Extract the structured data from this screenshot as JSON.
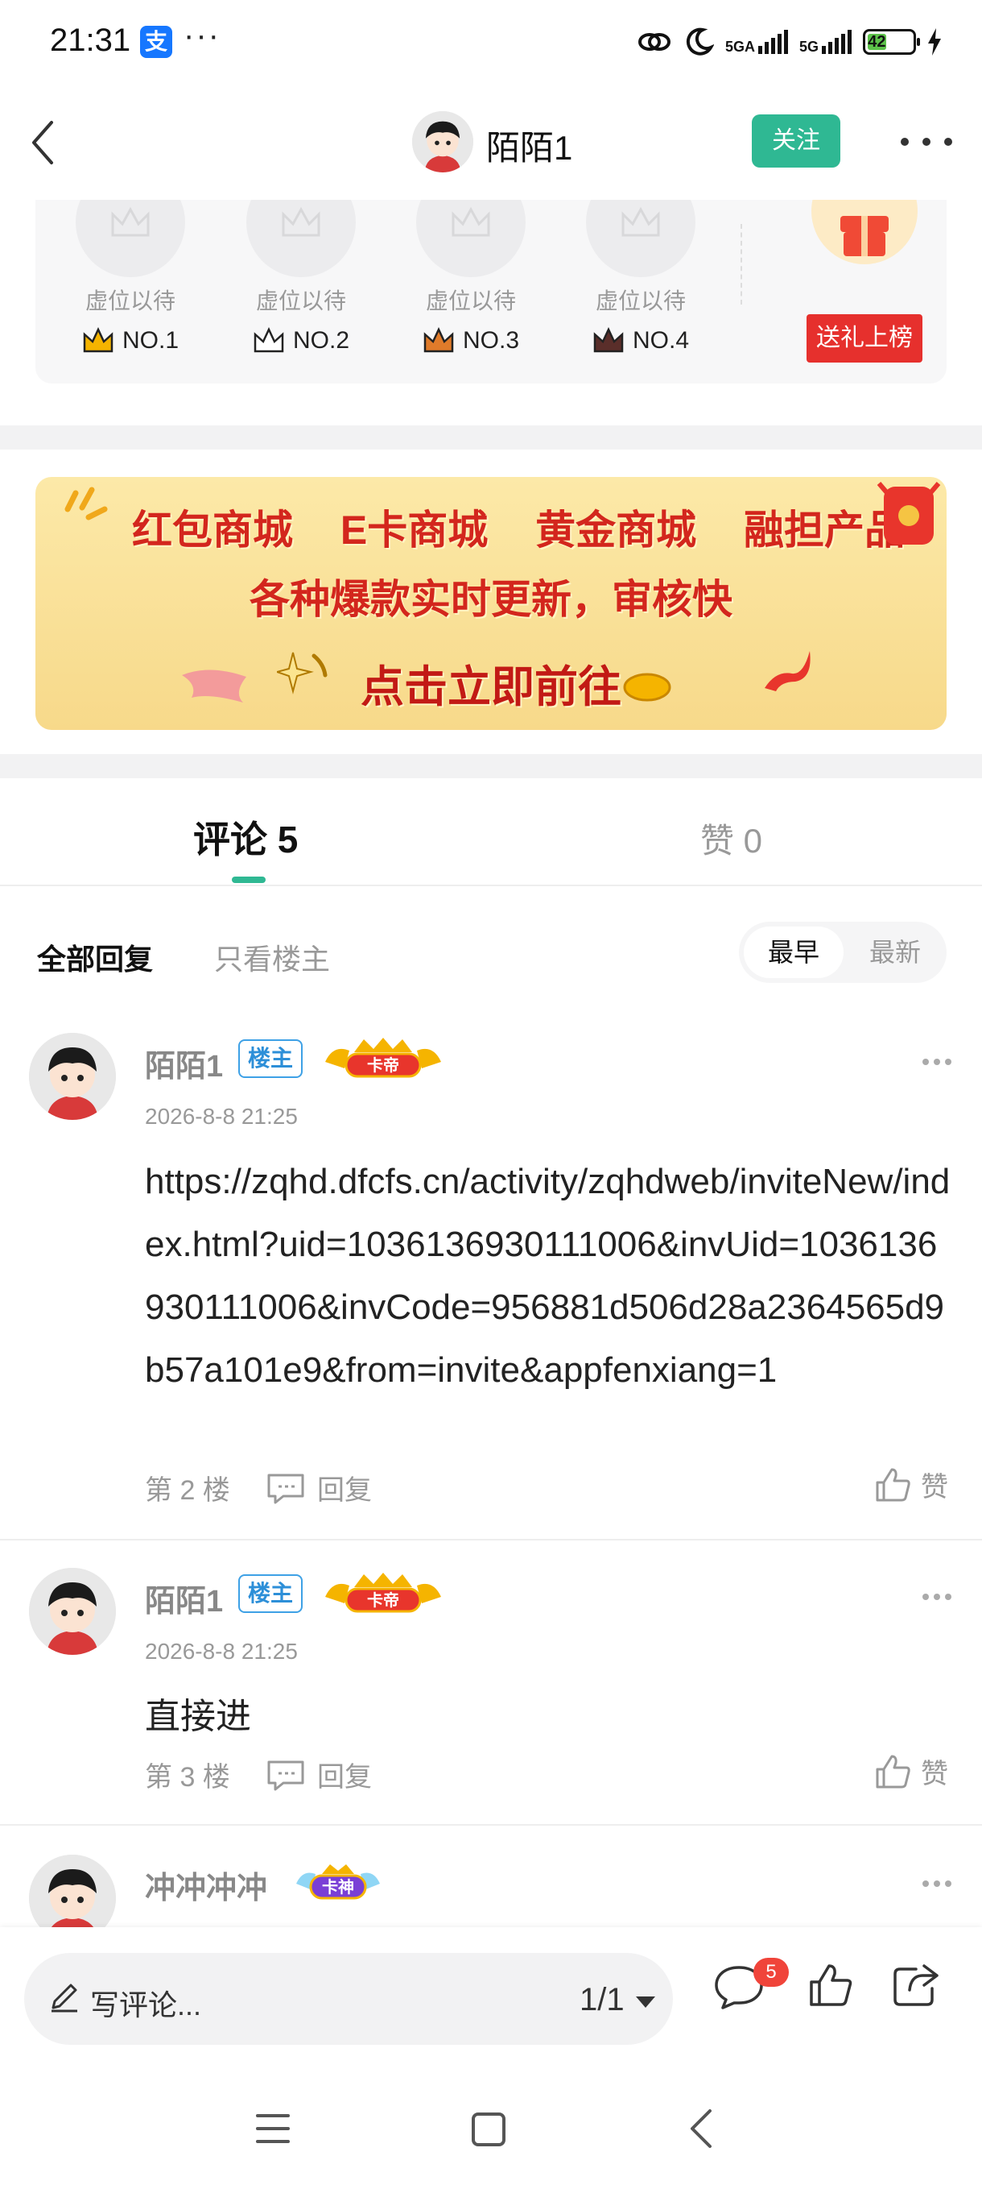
{
  "status_bar": {
    "time": "21:31",
    "alipay_glyph": "支",
    "dots": "···",
    "network_1": "5GA",
    "network_2": "5G",
    "battery": "42"
  },
  "header": {
    "username": "陌陌1",
    "follow_label": "关注"
  },
  "ranking": {
    "slots": [
      {
        "label": "虚位以待",
        "rank": "NO.1",
        "crown_color": "#f5b400"
      },
      {
        "label": "虚位以待",
        "rank": "NO.2",
        "crown_color": "#3a3a3a"
      },
      {
        "label": "虚位以待",
        "rank": "NO.3",
        "crown_color": "#e07b2a"
      },
      {
        "label": "虚位以待",
        "rank": "NO.4",
        "crown_color": "#5a2e2a"
      }
    ],
    "gift_button": "送礼上榜"
  },
  "banner": {
    "items": [
      "红包商城",
      "E卡商城",
      "黄金商城",
      "融担产品"
    ],
    "subtitle": "各种爆款实时更新，审核快",
    "cta": "点击立即前往"
  },
  "tabs": {
    "comments": "评论 5",
    "likes": "赞 0"
  },
  "filters": {
    "all": "全部回复",
    "owner_only": "只看楼主",
    "sort_earliest": "最早",
    "sort_latest": "最新"
  },
  "comments": [
    {
      "name": "陌陌1",
      "owner_tag": "楼主",
      "badge": "卡帝",
      "time": "2026-8-8 21:25",
      "text": "https://zqhd.dfcfs.cn/activity/zqhdweb/inviteNew/index.html?uid=1036136930111006&invUid=1036136930111006&invCode=956881d506d28a2364565d9b57a101e9&from=invite&appfenxiang=1",
      "floor": "第 2 楼",
      "reply": "回复",
      "like": "赞"
    },
    {
      "name": "陌陌1",
      "owner_tag": "楼主",
      "badge": "卡帝",
      "time": "2026-8-8 21:25",
      "text": "直接进",
      "floor": "第 3 楼",
      "reply": "回复",
      "like": "赞"
    },
    {
      "name": "冲冲冲冲",
      "badge": "卡神"
    }
  ],
  "bottom_bar": {
    "placeholder": "写评论...",
    "page": "1/1",
    "comment_badge": "5"
  },
  "colors": {
    "accent": "#2fb893",
    "gift_red": "#e6302d",
    "owner_blue": "#2d8fd8",
    "badge_red": "#f0443a"
  }
}
